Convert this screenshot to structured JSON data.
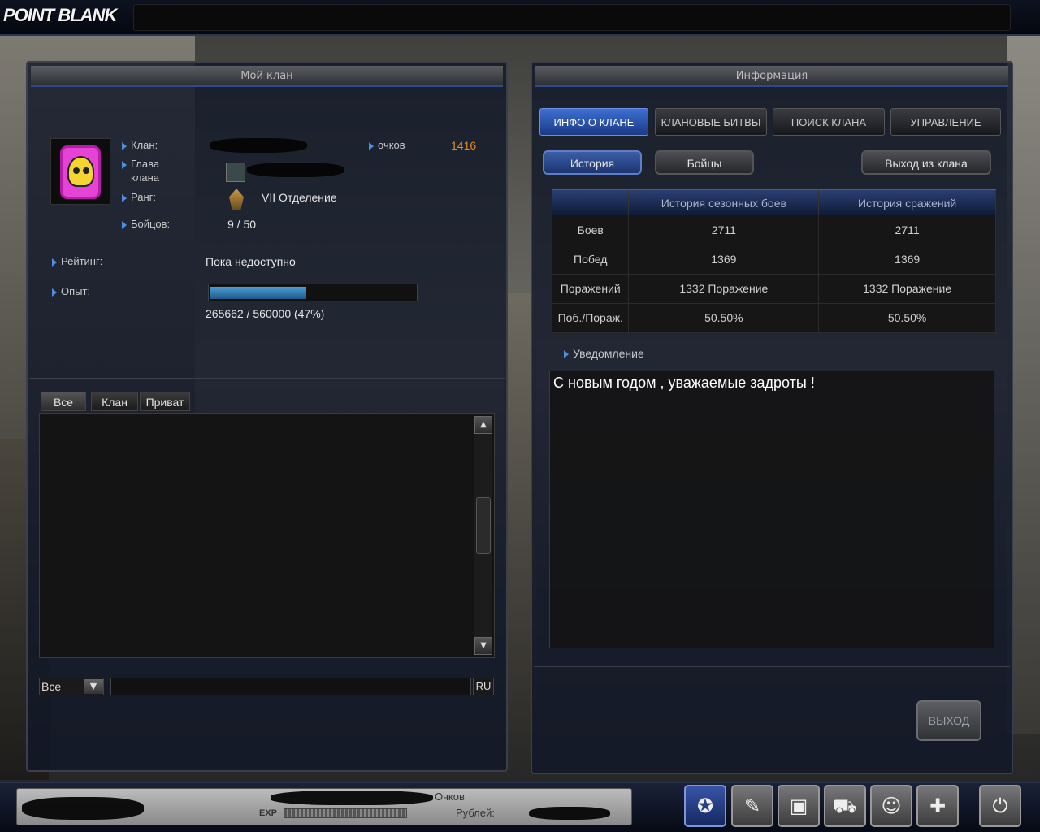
{
  "app": {
    "logo": "POINT BLANK"
  },
  "left_panel": {
    "title": "Мой клан",
    "clan_label": "Клан:",
    "leader_label_1": "Глава",
    "leader_label_2": "клана",
    "rank_label": "Ранг:",
    "rank_value": "VII Отделение",
    "fighters_label": "Бойцов:",
    "fighters_value": "9 / 50",
    "points_label": "очков",
    "points_value": "1416",
    "rating_label": "Рейтинг:",
    "rating_value": "Пока недоступно",
    "exp_label": "Опыт:",
    "exp_value": "265662 / 560000 (47%)",
    "exp_fraction": 0.47,
    "chat_tabs": [
      "Все",
      "Клан",
      "Приват"
    ],
    "chat_channel": "Все",
    "chat_lang": "RU"
  },
  "right_panel": {
    "title": "Информация",
    "tabs": [
      "ИНФО О КЛАНЕ",
      "КЛАНОВЫЕ БИТВЫ",
      "ПОИСК КЛАНА",
      "УПРАВЛЕНИЕ"
    ],
    "sub_buttons": {
      "history": "История",
      "fighters": "Бойцы",
      "leave": "Выход из клана"
    },
    "table": {
      "headers": [
        "",
        "История сезонных боев",
        "История сражений"
      ],
      "rows": [
        [
          "Боев",
          "2711",
          "2711"
        ],
        [
          "Побед",
          "1369",
          "1369"
        ],
        [
          "Поражений",
          "1332 Поражение",
          "1332 Поражение"
        ],
        [
          "Поб./Пораж.",
          "50.50%",
          "50.50%"
        ]
      ]
    },
    "notice_label": "Уведомление",
    "notice_text": "С новым годом , уважаемые задроты !",
    "exit_button": "ВЫХОД"
  },
  "bottom": {
    "exp_label": "EXP",
    "points_label": "Очков",
    "rubles_label": "Рублей:"
  },
  "colors": {
    "accent": "#3e6fd1",
    "points": "#e88a1a",
    "clan_emblem": "#e542d6"
  }
}
